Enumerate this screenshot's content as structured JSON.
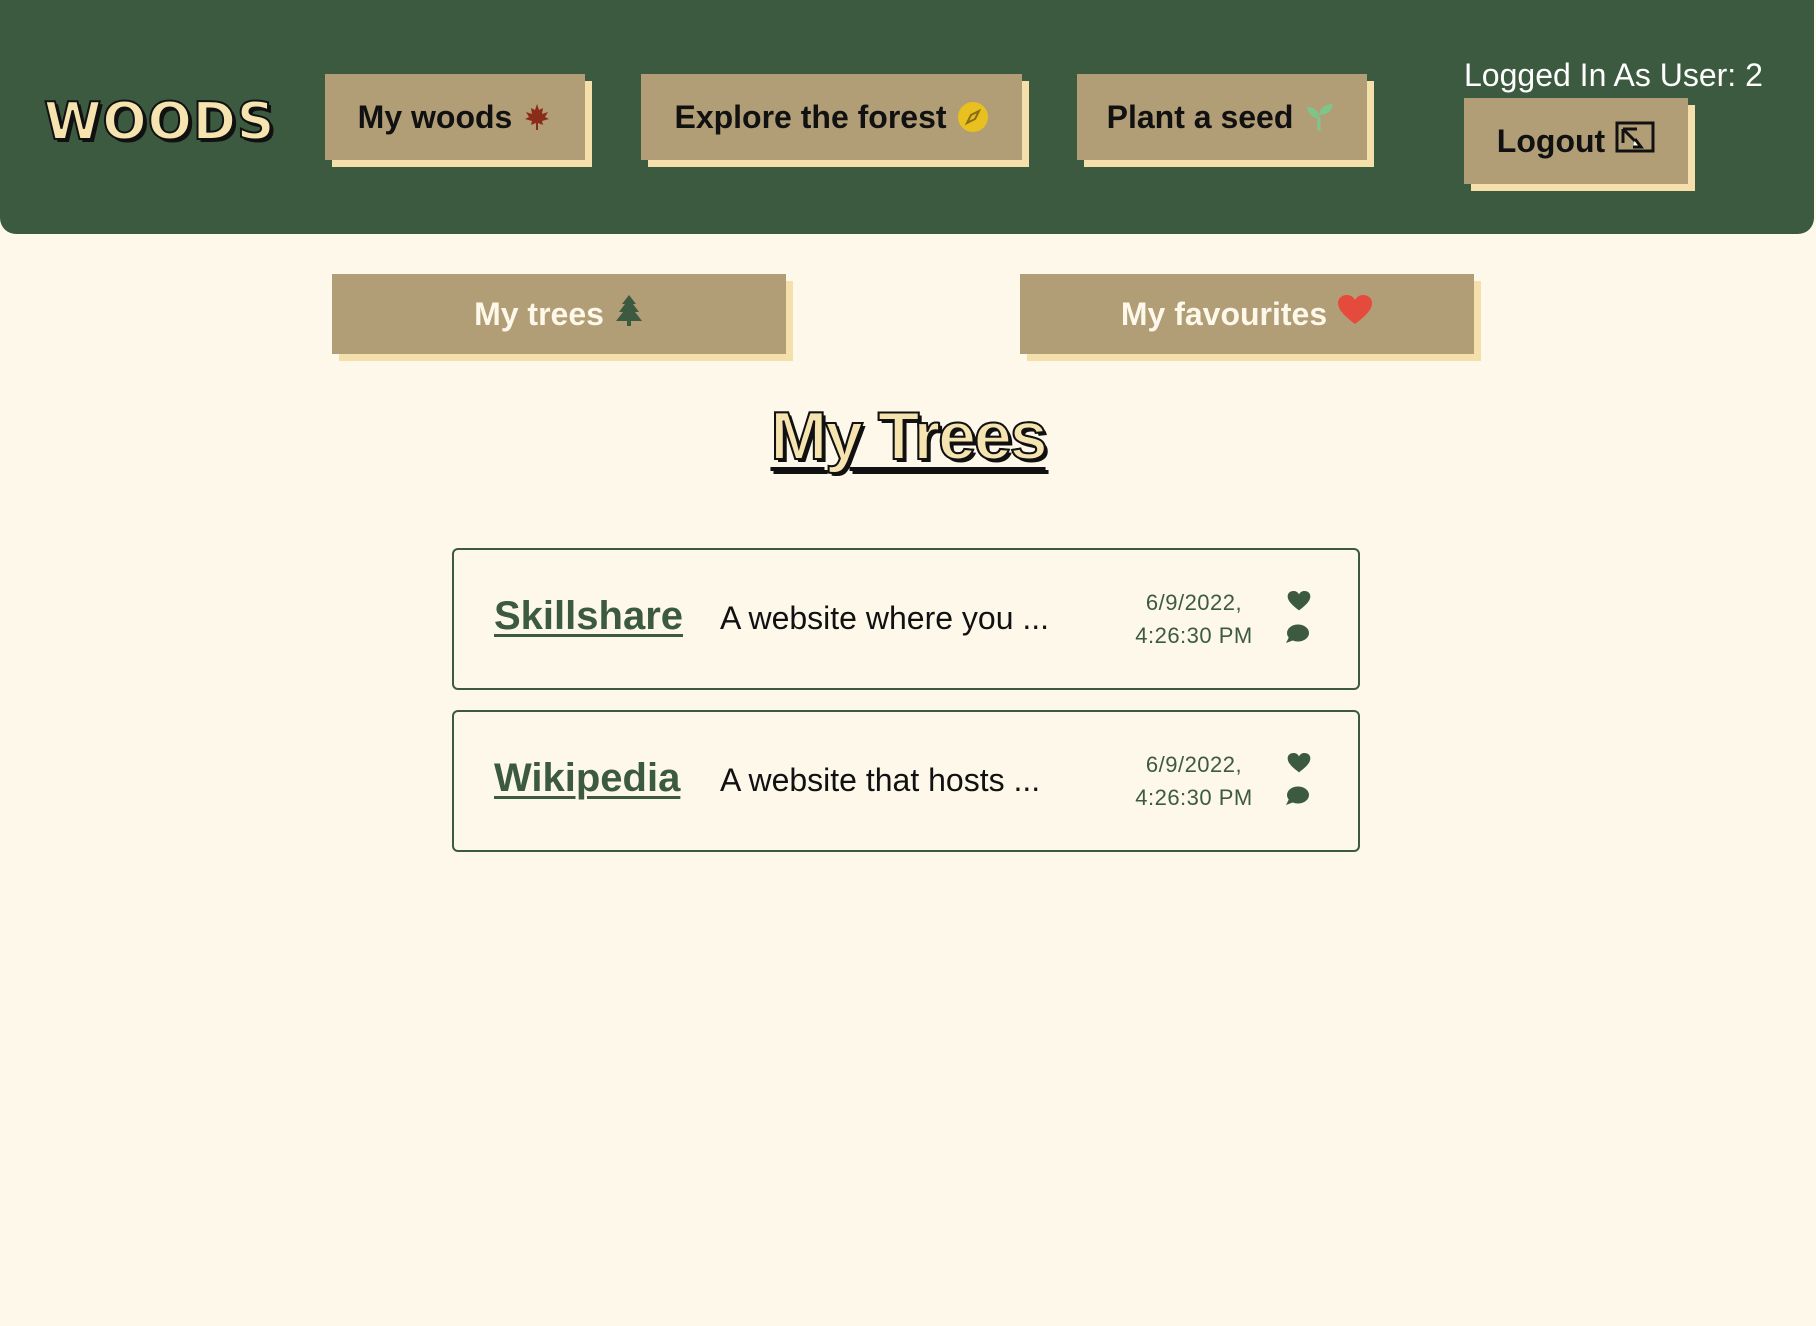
{
  "header": {
    "logo": "WOODS",
    "nav": {
      "my_woods": {
        "label": "My woods",
        "icon": "maple-leaf-icon"
      },
      "explore": {
        "label": "Explore the forest",
        "icon": "compass-icon"
      },
      "plant": {
        "label": "Plant a seed",
        "icon": "seedling-icon"
      }
    },
    "user": {
      "label": "Logged In As User: 2",
      "logout_label": "Logout",
      "logout_icon": "logout-icon"
    }
  },
  "tabs": {
    "my_trees": {
      "label": "My trees",
      "icon": "tree-icon"
    },
    "my_favourites": {
      "label": "My favourites",
      "icon": "heart-icon"
    }
  },
  "page_title": "My Trees",
  "trees": [
    {
      "name": "Skillshare",
      "description": "A website where you ...",
      "date": "6/9/2022,",
      "time": "4:26:30 PM"
    },
    {
      "name": "Wikipedia",
      "description": "A website that hosts ...",
      "date": "6/9/2022,",
      "time": "4:26:30 PM"
    }
  ],
  "colors": {
    "header_bg": "#3c5a3f",
    "page_bg": "#fdf8ea",
    "button_bg": "#b29e76",
    "button_shadow": "#f5dfab",
    "accent_green": "#3c5a3f",
    "maple_red": "#8b2c1a",
    "compass_yellow": "#e8c020",
    "seedling_green": "#7ec58a",
    "heart_red": "#e54b3c"
  }
}
